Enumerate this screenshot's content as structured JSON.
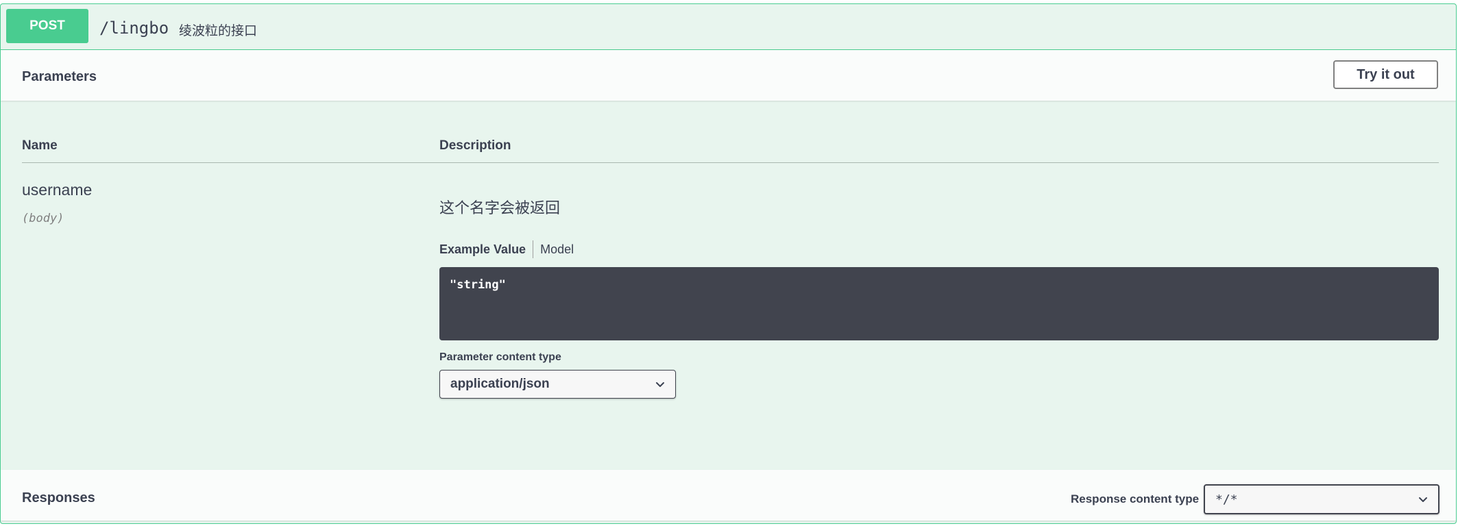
{
  "operation": {
    "method": "POST",
    "path": "/lingbo",
    "summary": "绫波粒的接口"
  },
  "parameters_section": {
    "title": "Parameters",
    "try_button": "Try it out",
    "columns": {
      "name": "Name",
      "description": "Description"
    },
    "param": {
      "name": "username",
      "in": "(body)",
      "description": "这个名字会被返回",
      "example_tabs": {
        "active": "Example Value",
        "model": "Model"
      },
      "example_value": "\"string\"",
      "content_type_label": "Parameter content type",
      "content_type_value": "application/json"
    }
  },
  "responses_section": {
    "title": "Responses",
    "content_type_label": "Response content type",
    "content_type_value": "*/*"
  },
  "colors": {
    "post_accent": "#49cc90",
    "block_bg": "#e8f5ee",
    "code_bg": "#41444e",
    "text": "#3b4151"
  }
}
